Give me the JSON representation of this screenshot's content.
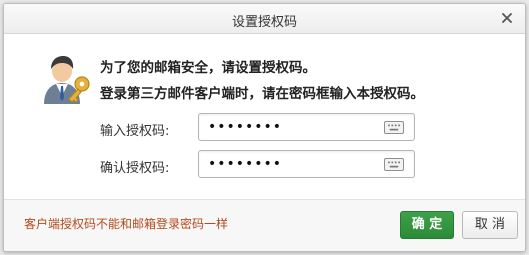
{
  "dialog": {
    "title": "设置授权码",
    "close_icon": "close-icon",
    "avatar_icon": "user-key-icon",
    "message_line1": "为了您的邮箱安全，请设置授权码。",
    "message_line2": "登录第三方邮件客户端时，请在密码框输入本授权码。",
    "fields": [
      {
        "label": "输入授权码:",
        "value": "••••••••",
        "keyboard_icon": "keyboard-icon"
      },
      {
        "label": "确认授权码:",
        "value": "••••••••",
        "keyboard_icon": "keyboard-icon"
      }
    ],
    "hint": "客户端授权码不能和邮箱登录密码一样",
    "ok_label": "确 定",
    "cancel_label": "取 消"
  },
  "colors": {
    "ok_button": "#34973f",
    "hint_text": "#b34a1c"
  }
}
